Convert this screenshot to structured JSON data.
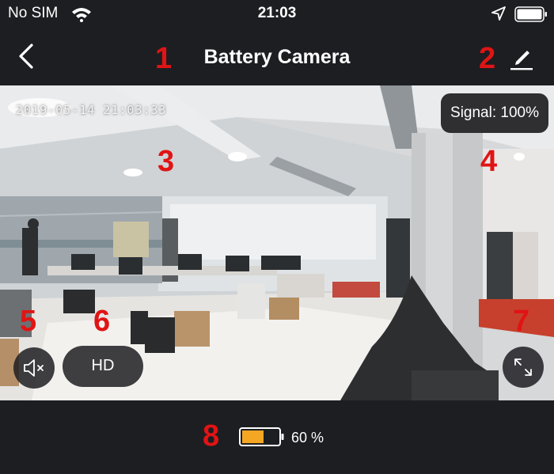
{
  "status_bar": {
    "carrier": "No SIM",
    "time": "21:03"
  },
  "nav": {
    "title": "Battery Camera"
  },
  "video": {
    "timestamp": "2019-05-14 21:03:33",
    "signal": "Signal: 100%",
    "quality_label": "HD"
  },
  "battery": {
    "level": 0.6,
    "label": "60 %",
    "fill_color": "#f5a623"
  },
  "annotations": [
    "1",
    "2",
    "3",
    "4",
    "5",
    "6",
    "7",
    "8"
  ],
  "colors": {
    "background": "#1d1e22",
    "annotation": "#e01414"
  }
}
